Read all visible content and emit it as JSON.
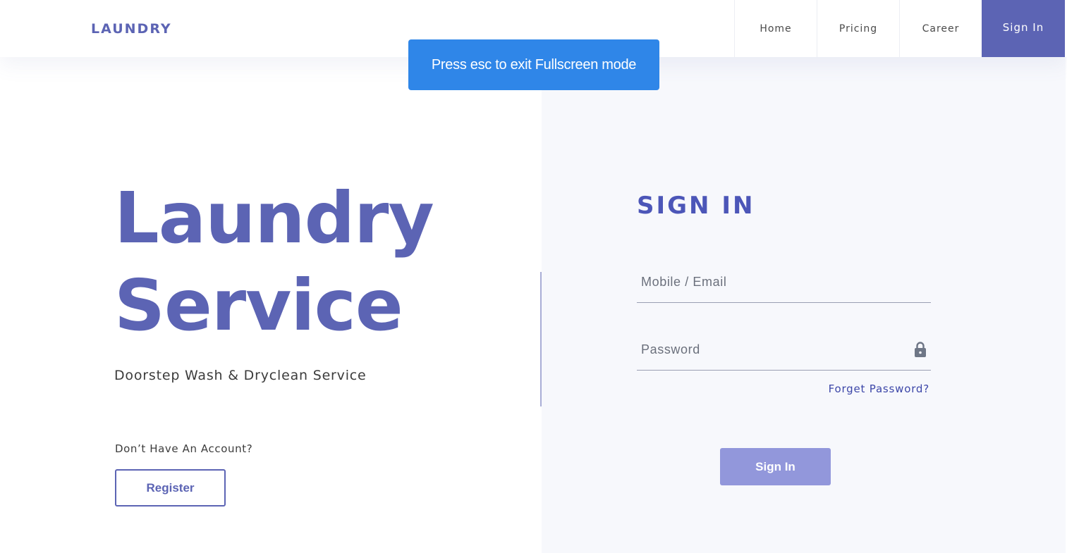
{
  "header": {
    "logo": "LAUNDRY",
    "nav": [
      {
        "label": "Home"
      },
      {
        "label": "Pricing"
      },
      {
        "label": "Career"
      }
    ],
    "signin_label": "Sign In"
  },
  "toast": {
    "message": "Press esc to exit Fullscreen mode"
  },
  "hero": {
    "title_line1": "Laundry",
    "title_line2": "Service",
    "subtitle": "Doorstep Wash & Dryclean Service",
    "no_account_text": "Don’t Have An Account?",
    "register_label": "Register"
  },
  "signin_form": {
    "heading": "SIGN IN",
    "email_placeholder": "Mobile / Email",
    "email_value": "",
    "password_placeholder": "Password",
    "password_value": "",
    "password_icon": "lock-icon",
    "forget_label": "Forget Password?",
    "submit_label": "Sign In"
  },
  "colors": {
    "brand": "#5c64b4",
    "toast": "#2f86e8",
    "panel_bg": "#f7f8fc",
    "submit_disabled": "#9297db",
    "link": "#3c46a8"
  }
}
